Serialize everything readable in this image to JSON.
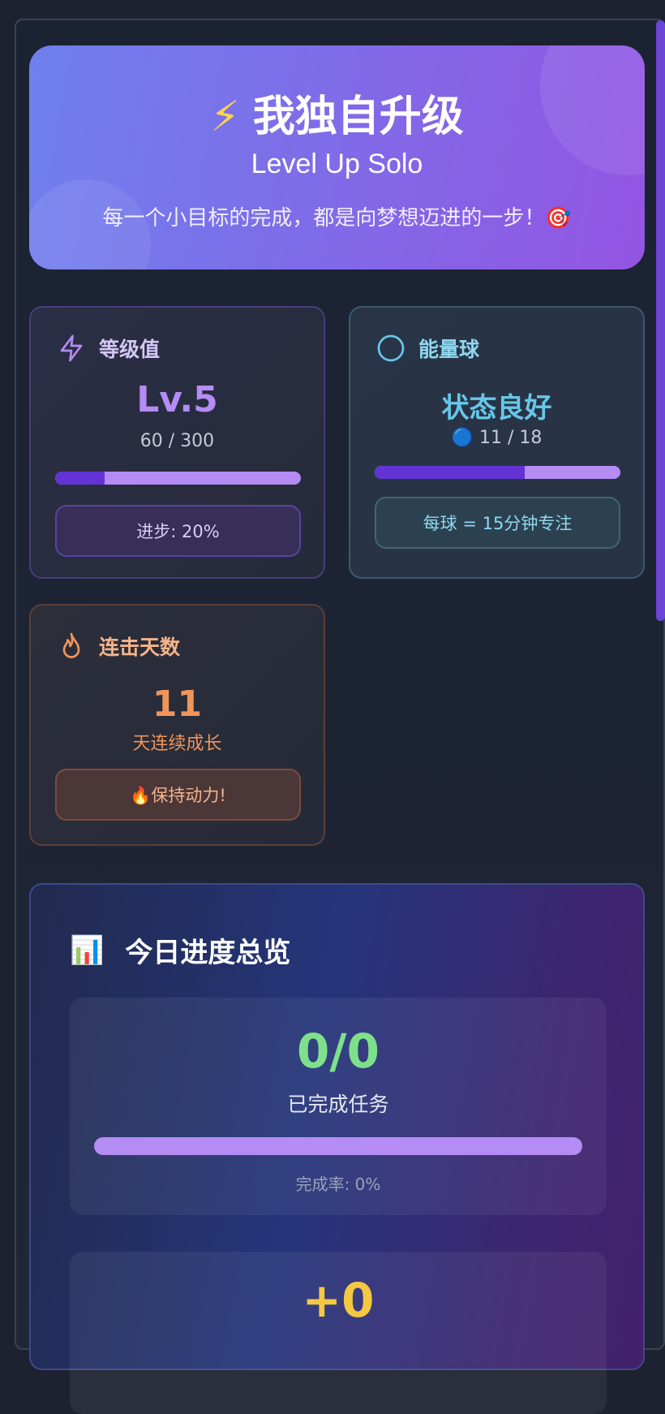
{
  "hero": {
    "title_icon": "⚡",
    "title": "我独自升级",
    "subtitle": "Level Up Solo",
    "motto": "每一个小目标的完成，都是向梦想迈进的一步！🎯"
  },
  "level_card": {
    "label": "等级值",
    "level": "Lv.5",
    "xp": "60 / 300",
    "progress_fraction": 0.2,
    "progress_text": "进步: 20%",
    "color": "#b48cf4"
  },
  "energy_card": {
    "label": "能量球",
    "status": "状态良好",
    "count": "🔵 11 / 18",
    "progress_fraction": 0.611,
    "note": "每球 = 15分钟专注",
    "color": "#67c7e8"
  },
  "streak_card": {
    "label": "连击天数",
    "days": "11",
    "days_label": "天连续成长",
    "motivation": "🔥保持动力!",
    "color": "#f0955a"
  },
  "overview": {
    "icon": "📊",
    "title": "今日进度总览",
    "tasks_done": "0/0",
    "tasks_label": "已完成任务",
    "completion_rate_text": "完成率: 0%",
    "points": "+0",
    "tasks_color": "#7ee08a",
    "points_color": "#f5c842"
  }
}
